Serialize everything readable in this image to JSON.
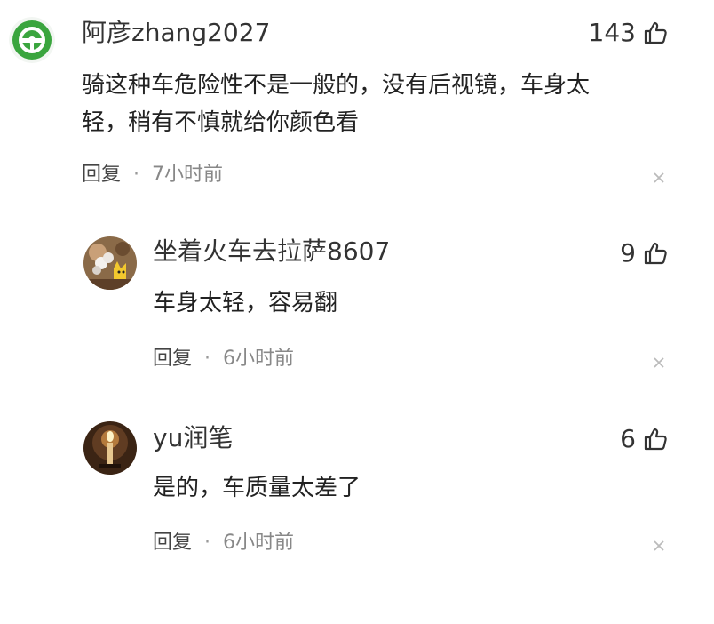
{
  "comments": [
    {
      "username": "阿彦zhang2027",
      "likes": "143",
      "text_lines": [
        "骑这种车危险性不是一般的，没有后视镜，车身太",
        "轻，稍有不慎就给你颜色看"
      ],
      "reply_label": "回复",
      "dot": "·",
      "time": "7小时前",
      "avatar_icon": "steering-wheel-icon",
      "avatar_color": "#3aa53e"
    },
    {
      "username": "坐着火车去拉萨8607",
      "likes": "9",
      "text_lines": [
        "车身太轻，容易翻"
      ],
      "reply_label": "回复",
      "dot": "·",
      "time": "6小时前",
      "avatar_icon": "flower-cat-icon",
      "avatar_color": "#7a5a3a"
    },
    {
      "username": "yu润笔",
      "likes": "6",
      "text_lines": [
        "是的，车质量太差了"
      ],
      "reply_label": "回复",
      "dot": "·",
      "time": "6小时前",
      "avatar_icon": "candle-icon",
      "avatar_color": "#5a3a22"
    }
  ]
}
